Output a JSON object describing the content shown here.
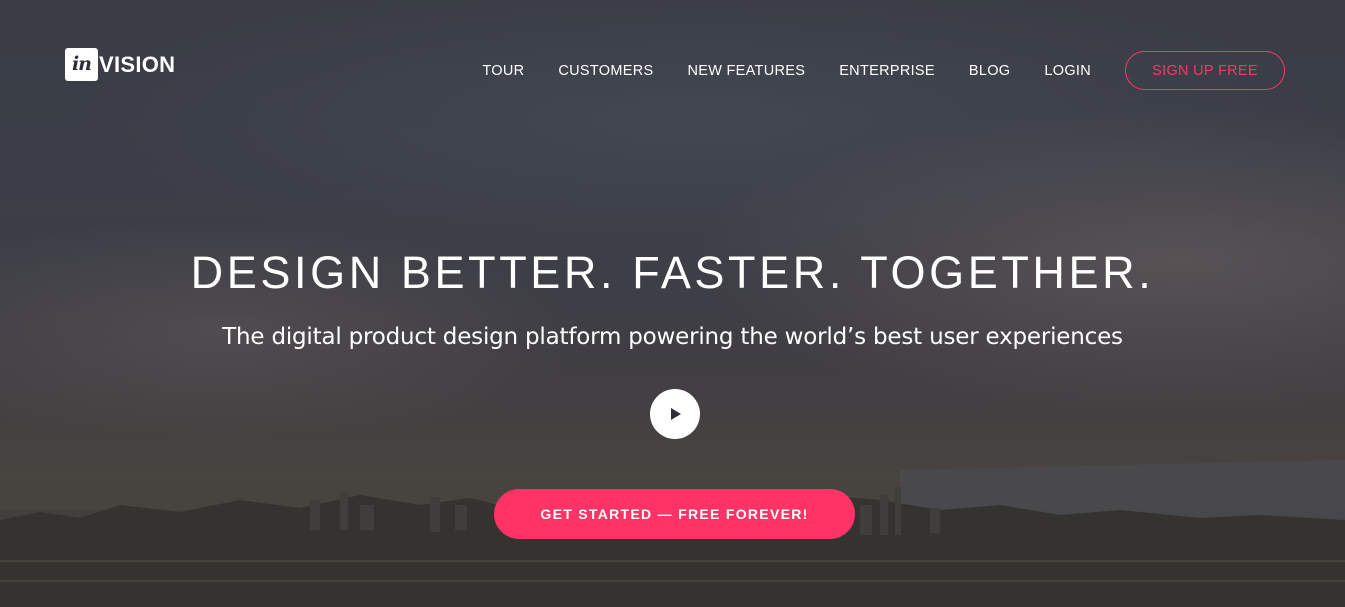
{
  "brand": {
    "logo_box_text": "in",
    "logo_rest_text": "VISION",
    "accent_color": "#ff3366"
  },
  "nav": {
    "items": [
      {
        "label": "TOUR"
      },
      {
        "label": "CUSTOMERS"
      },
      {
        "label": "NEW FEATURES"
      },
      {
        "label": "ENTERPRISE"
      },
      {
        "label": "BLOG"
      },
      {
        "label": "LOGIN"
      }
    ],
    "signup_label": "SIGN UP FREE"
  },
  "hero": {
    "headline": "DESIGN BETTER. FASTER. TOGETHER.",
    "subheadline": "The digital product design platform powering the world’s best user experiences",
    "play_icon": "play-icon",
    "cta_label": "GET STARTED — FREE FOREVER!"
  }
}
